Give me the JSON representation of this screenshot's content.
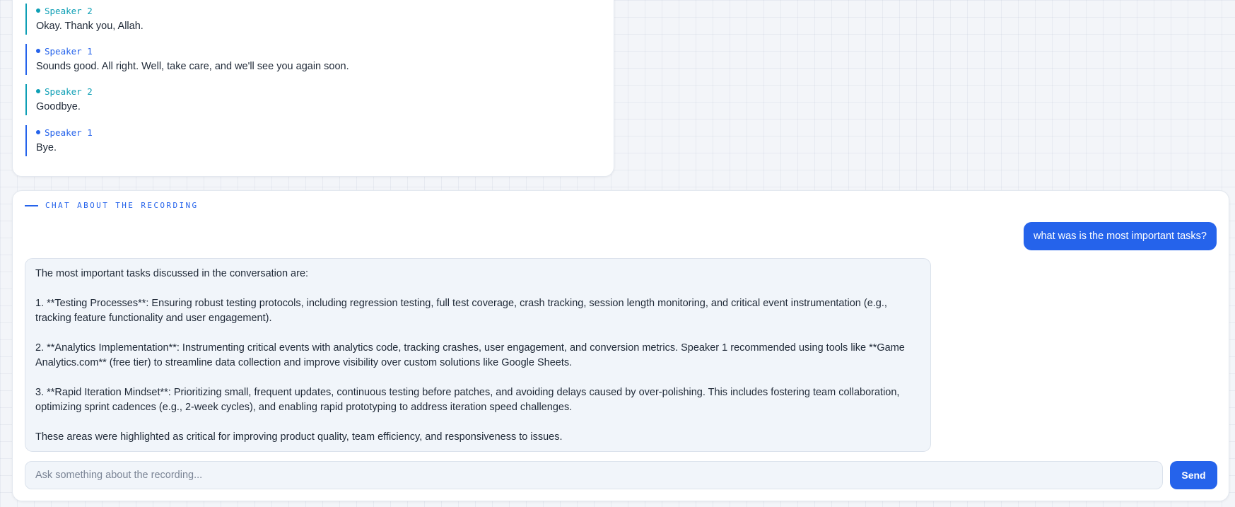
{
  "transcript": {
    "utterances": [
      {
        "speaker": "Speaker 2",
        "text": "Okay. Thank you, Allah."
      },
      {
        "speaker": "Speaker 1",
        "text": "Sounds good. All right. Well, take care, and we'll see you again soon."
      },
      {
        "speaker": "Speaker 2",
        "text": "Goodbye."
      },
      {
        "speaker": "Speaker 1",
        "text": "Bye."
      }
    ]
  },
  "chat": {
    "section_label": "CHAT ABOUT THE RECORDING",
    "user_message": "what was is the most important tasks?",
    "assistant_message": {
      "paragraphs": [
        "The most important tasks discussed in the conversation are:",
        "1. **Testing Processes**: Ensuring robust testing protocols, including regression testing, full test coverage, crash tracking, session length monitoring, and critical event instrumentation (e.g., tracking feature functionality and user engagement).",
        "2. **Analytics Implementation**: Instrumenting critical events with analytics code, tracking crashes, user engagement, and conversion metrics. Speaker 1 recommended using tools like **Game Analytics.com** (free tier) to streamline data collection and improve visibility over custom solutions like Google Sheets.",
        "3. **Rapid Iteration Mindset**: Prioritizing small, frequent updates, continuous testing before patches, and avoiding delays caused by over-polishing. This includes fostering team collaboration, optimizing sprint cadences (e.g., 2-week cycles), and enabling rapid prototyping to address iteration speed challenges.",
        "These areas were highlighted as critical for improving product quality, team efficiency, and responsiveness to issues."
      ]
    },
    "input": {
      "placeholder": "Ask something about the recording...",
      "value": ""
    },
    "send_label": "Send"
  },
  "colors": {
    "accent": "#2563eb",
    "speaker2": "#0e9fb5",
    "bubble_bg": "#f1f5fa"
  }
}
